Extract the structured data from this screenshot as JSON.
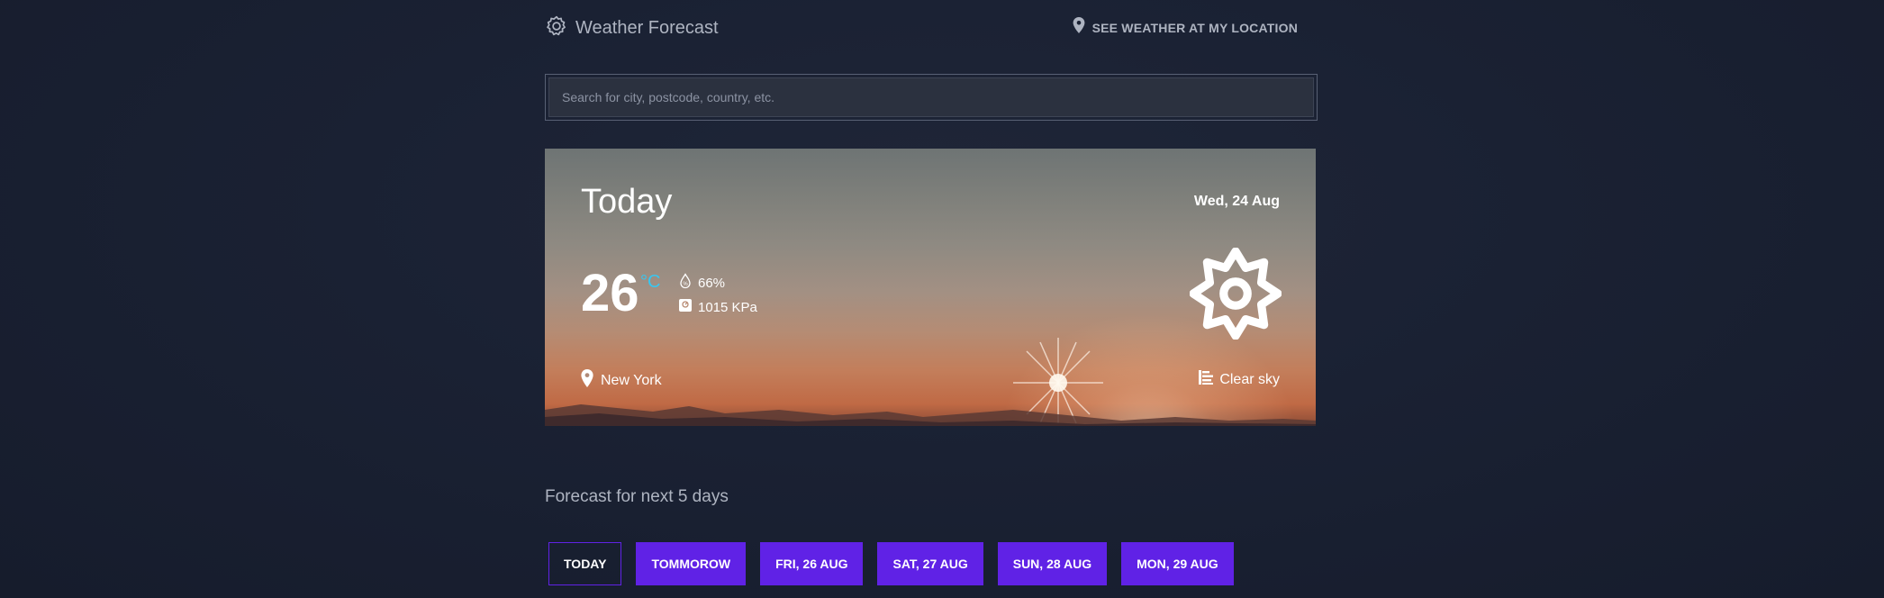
{
  "header": {
    "app_title": "Weather Forecast",
    "location_link_label": "SEE WEATHER AT MY LOCATION",
    "icons": {
      "brand": "gear-icon",
      "location": "map-pin-icon"
    }
  },
  "search": {
    "placeholder": "Search for city, postcode, country, etc.",
    "value": ""
  },
  "today": {
    "title": "Today",
    "date": "Wed, 24 Aug",
    "temperature": "26",
    "unit": "°C",
    "humidity": "66%",
    "pressure": "1015 KPa",
    "city": "New York",
    "condition": "Clear sky",
    "condition_icon": "sun-icon",
    "colors": {
      "unit_accent": "#38c6f0"
    }
  },
  "forecast": {
    "title": "Forecast for next 5 days",
    "tabs": [
      {
        "label": "TODAY",
        "active": true
      },
      {
        "label": "TOMMOROW",
        "active": false
      },
      {
        "label": "FRI, 26 AUG",
        "active": false
      },
      {
        "label": "SAT, 27 AUG",
        "active": false
      },
      {
        "label": "SUN, 28 AUG",
        "active": false
      },
      {
        "label": "MON, 29 AUG",
        "active": false
      }
    ],
    "colors": {
      "tab_accent": "#6022e6"
    }
  }
}
